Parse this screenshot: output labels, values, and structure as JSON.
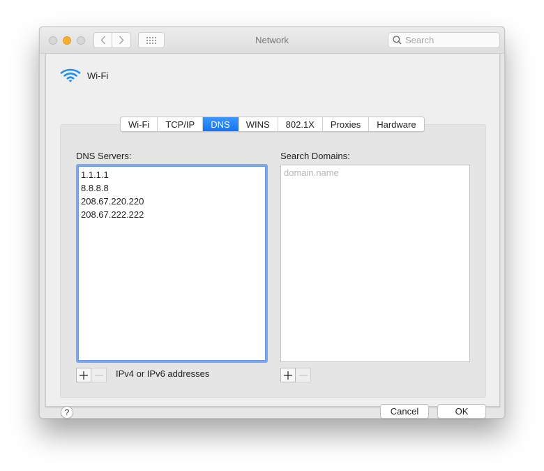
{
  "window": {
    "title": "Network",
    "traffic_lights": [
      "close",
      "minimize",
      "zoom"
    ],
    "search": {
      "placeholder": "Search",
      "value": ""
    }
  },
  "sheet": {
    "interface_name": "Wi-Fi",
    "interface_icon": "wifi-icon",
    "tabs": [
      {
        "label": "Wi-Fi",
        "active": false
      },
      {
        "label": "TCP/IP",
        "active": false
      },
      {
        "label": "DNS",
        "active": true
      },
      {
        "label": "WINS",
        "active": false
      },
      {
        "label": "802.1X",
        "active": false
      },
      {
        "label": "Proxies",
        "active": false
      },
      {
        "label": "Hardware",
        "active": false
      }
    ],
    "dns": {
      "label": "DNS Servers:",
      "servers": [
        "1.1.1.1",
        "8.8.8.8",
        "208.67.220.220",
        "208.67.222.222"
      ],
      "hint": "IPv4 or IPv6 addresses",
      "add_label": "+",
      "remove_label": "−"
    },
    "search_domains": {
      "label": "Search Domains:",
      "placeholder": "domain.name",
      "domains": [],
      "add_label": "+",
      "remove_label": "−"
    },
    "help_label": "?",
    "cancel_label": "Cancel",
    "ok_label": "OK"
  },
  "colors": {
    "accent": "#1a7bf5",
    "focus_ring": "#7ea8ee",
    "minimize": "#f8b033"
  }
}
